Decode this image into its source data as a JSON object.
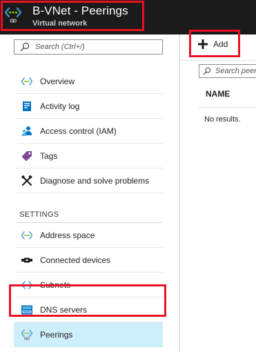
{
  "header": {
    "title": "B-VNet - Peerings",
    "subtitle": "Virtual network",
    "icon": "virtual-network-icon"
  },
  "menu": {
    "search": {
      "placeholder": "Search (Ctrl+/)",
      "value": ""
    },
    "items": [
      {
        "label": "Overview",
        "icon": "overview-icon"
      },
      {
        "label": "Activity log",
        "icon": "activity-log-icon"
      },
      {
        "label": "Access control (IAM)",
        "icon": "access-control-icon"
      },
      {
        "label": "Tags",
        "icon": "tag-icon"
      },
      {
        "label": "Diagnose and solve problems",
        "icon": "wrench-icon"
      }
    ],
    "settings_heading": "SETTINGS",
    "settings_items": [
      {
        "label": "Address space",
        "icon": "address-space-icon"
      },
      {
        "label": "Connected devices",
        "icon": "connected-devices-icon"
      },
      {
        "label": "Subnets",
        "icon": "subnets-icon"
      },
      {
        "label": "DNS servers",
        "icon": "dns-servers-icon"
      },
      {
        "label": "Peerings",
        "icon": "peerings-icon",
        "selected": true
      }
    ]
  },
  "content": {
    "add_label": "Add",
    "search": {
      "placeholder": "Search peerings",
      "value": ""
    },
    "table": {
      "columns": [
        "NAME"
      ],
      "empty_text": "No results."
    }
  },
  "colors": {
    "header_bg": "#1b1b1b",
    "highlight_border": "#e81123",
    "selected_bg": "#cdeefb",
    "accent_blue": "#0072c6",
    "vnet_green": "#7fba00"
  }
}
